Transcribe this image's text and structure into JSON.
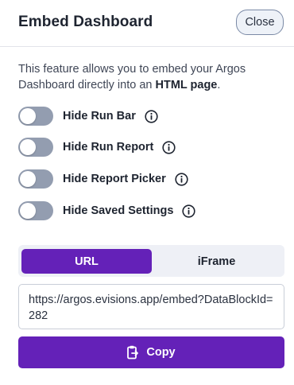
{
  "header": {
    "title": "Embed Dashboard",
    "close_label": "Close"
  },
  "description": {
    "text_before": "This feature allows you to embed your Argos Dashboard directly into an ",
    "bold_text": "HTML page",
    "text_after": "."
  },
  "toggles": [
    {
      "label": "Hide Run Bar",
      "checked": false,
      "icon": "info-icon"
    },
    {
      "label": "Hide Run Report",
      "checked": false,
      "icon": "info-icon"
    },
    {
      "label": "Hide Report Picker",
      "checked": false,
      "icon": "info-icon"
    },
    {
      "label": "Hide Saved Settings",
      "checked": false,
      "icon": "info-icon"
    }
  ],
  "tabs": {
    "url_label": "URL",
    "iframe_label": "iFrame",
    "selected": "URL"
  },
  "embed_value": "https://argos.evisions.app/embed?DataBlockId=282",
  "copy_label": "Copy",
  "colors": {
    "accent": "#6421b8",
    "toggle_off": "#939db0",
    "tab_track": "#eef0f6"
  }
}
